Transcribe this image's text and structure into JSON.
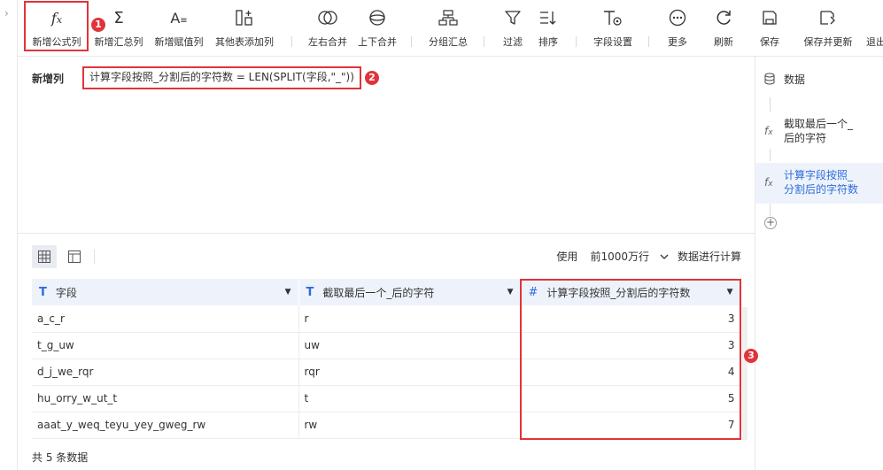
{
  "toolbar": {
    "items": [
      {
        "label": "新增公式列",
        "icon": "fx-icon"
      },
      {
        "label": "新增汇总列",
        "icon": "sigma-icon"
      },
      {
        "label": "新增赋值列",
        "icon": "assign-icon"
      },
      {
        "label": "其他表添加列",
        "icon": "add-column-icon"
      },
      {
        "label": "左右合并",
        "icon": "lr-merge-icon"
      },
      {
        "label": "上下合并",
        "icon": "tb-merge-icon"
      },
      {
        "label": "分组汇总",
        "icon": "group-icon"
      },
      {
        "label": "过滤",
        "icon": "filter-icon"
      },
      {
        "label": "排序",
        "icon": "sort-icon"
      },
      {
        "label": "字段设置",
        "icon": "field-settings-icon"
      },
      {
        "label": "更多",
        "icon": "more-icon"
      },
      {
        "label": "刷新",
        "icon": "refresh-icon"
      },
      {
        "label": "保存",
        "icon": "save-icon"
      },
      {
        "label": "保存并更新",
        "icon": "save-update-icon"
      },
      {
        "label": "退出",
        "icon": "exit-icon"
      }
    ]
  },
  "editor": {
    "label": "新增列",
    "formula": "计算字段按照_分割后的字符数 = LEN(SPLIT(字段,\"_\"))"
  },
  "annotations": {
    "one": "1",
    "two": "2",
    "three": "3"
  },
  "steps": [
    {
      "label": "数据",
      "icon": "database-icon"
    },
    {
      "label": "截取最后一个_后的字符",
      "line1": "截取最后一个_",
      "line2": "后的字符",
      "icon": "fx-icon"
    },
    {
      "label": "计算字段按照_分割后的字符数",
      "line1": "计算字段按照_",
      "line2": "分割后的字符数",
      "icon": "fx-icon",
      "active": true
    }
  ],
  "options": {
    "use_label": "使用",
    "rows_select": "前1000万行",
    "calc_label": "数据进行计算"
  },
  "table": {
    "columns": [
      {
        "name": "字段",
        "type": "text"
      },
      {
        "name": "截取最后一个_后的字符",
        "type": "text"
      },
      {
        "name": "计算字段按照_分割后的字符数",
        "type": "number"
      }
    ],
    "rows": [
      [
        "a_c_r",
        "r",
        "3"
      ],
      [
        "t_g_uw",
        "uw",
        "3"
      ],
      [
        "d_j_we_rqr",
        "rqr",
        "4"
      ],
      [
        "hu_orry_w_ut_t",
        "t",
        "5"
      ],
      [
        "aaat_y_weq_teyu_yey_gweg_rw",
        "rw",
        "7"
      ]
    ]
  },
  "footer": {
    "count": "共 5 条数据"
  },
  "colors": {
    "accent": "#2f6cdb",
    "highlight": "#e0343a",
    "header_bg": "#eef3fb"
  }
}
